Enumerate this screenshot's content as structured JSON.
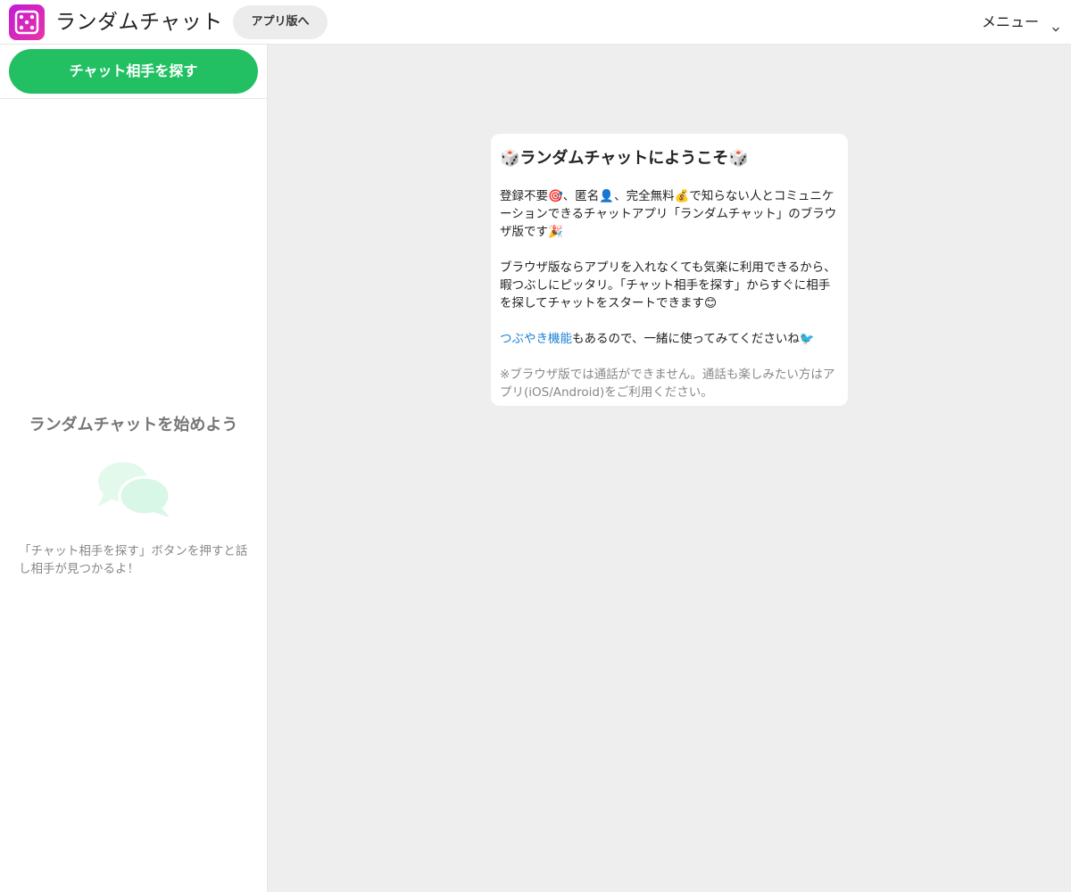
{
  "header": {
    "app_title": "ランダムチャット",
    "app_button_label": "アプリ版へ",
    "menu_label": "メニュー"
  },
  "sidebar": {
    "find_button_label": "チャット相手を探す",
    "empty_title": "ランダムチャットを始めよう",
    "empty_text": "「チャット相手を探す」ボタンを押すと話し相手が見つかるよ！"
  },
  "welcome": {
    "title": "🎲ランダムチャットにようこそ🎲",
    "p1": "登録不要🎯、匿名👤、完全無料💰で知らない人とコミュニケーションできるチャットアプリ「ランダムチャット」のブラウザ版です🎉",
    "p2": "ブラウザ版ならアプリを入れなくても気楽に利用できるから、暇つぶしにピッタリ。「チャット相手を探す」からすぐに相手を探してチャットをスタートできます😊",
    "p3_link": "つぶやき機能",
    "p3_rest": "もあるので、一緒に使ってみてくださいね🐦",
    "note": "※ブラウザ版では通話ができません。通話も楽しみたい方はアプリ(iOS/Android)をご利用ください。"
  },
  "colors": {
    "brand_gradient_start": "#c21ad6",
    "brand_gradient_end": "#e934a6",
    "primary_green": "#22c063",
    "link_blue": "#1a7fd4",
    "main_bg": "#eeeeee",
    "chat_icon_tint": "#d8f7e6"
  },
  "icons": {
    "logo": "dice-icon",
    "menu": "chevron-down-icon",
    "empty_state": "chat-bubbles-icon"
  }
}
